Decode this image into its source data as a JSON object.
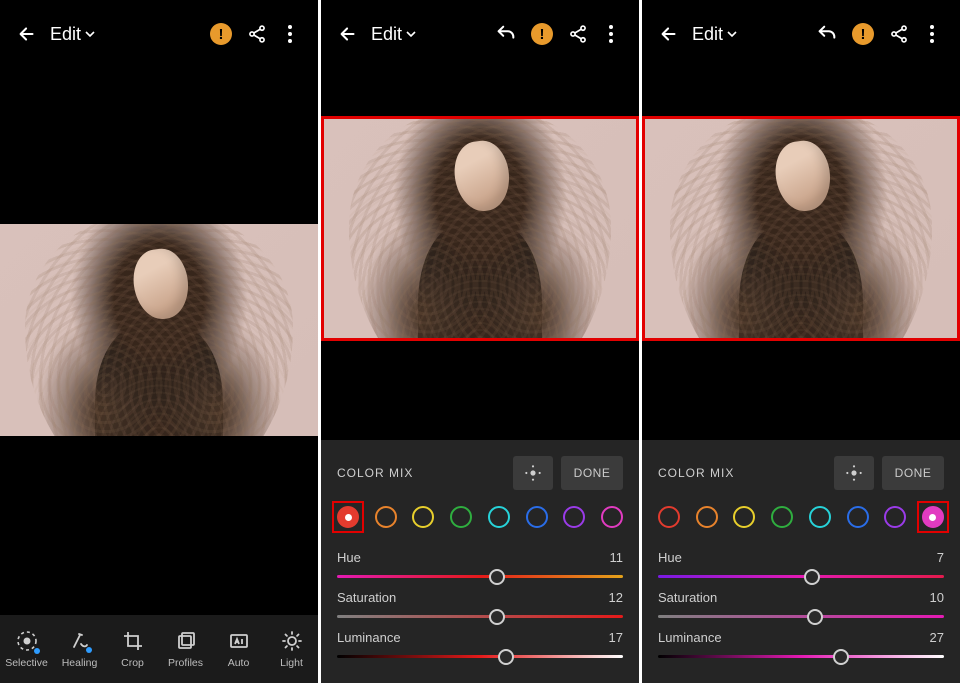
{
  "shared": {
    "title": "Edit",
    "warn_glyph": "!"
  },
  "panel0": {
    "tools": [
      {
        "label": "Selective"
      },
      {
        "label": "Healing"
      },
      {
        "label": "Crop"
      },
      {
        "label": "Profiles"
      },
      {
        "label": "Auto"
      },
      {
        "label": "Light"
      }
    ]
  },
  "mix_shared": {
    "panel_title": "COLOR MIX",
    "done_label": "DONE",
    "hue_label": "Hue",
    "sat_label": "Saturation",
    "lum_label": "Luminance",
    "swatch_colors": [
      "#e33b2e",
      "#e8832c",
      "#e8cf2c",
      "#2fae3f",
      "#27d3d9",
      "#2a6de8",
      "#9a3be8",
      "#e23bc1"
    ]
  },
  "panel1": {
    "selected_index": 0,
    "hue": "11",
    "sat": "12",
    "lum": "17"
  },
  "panel2": {
    "selected_index": 7,
    "hue": "7",
    "sat": "10",
    "lum": "27"
  }
}
